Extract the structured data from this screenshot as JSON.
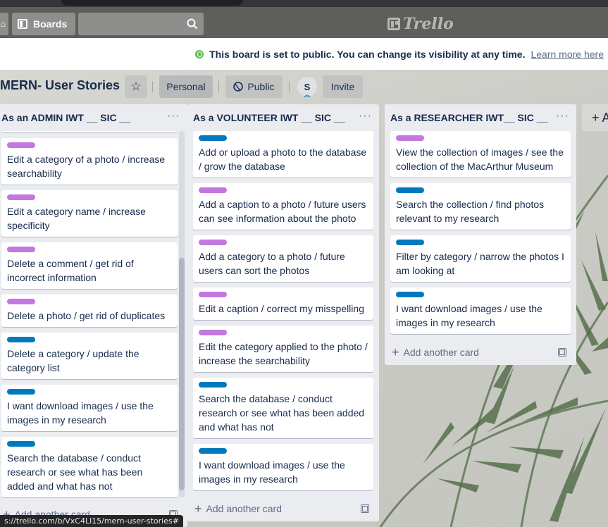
{
  "header": {
    "boards_label": "Boards",
    "logo_text": "Trello",
    "icons": [
      "home-icon",
      "boards-icon",
      "search-icon"
    ]
  },
  "banner": {
    "message": "This board is set to public. You can change its visibility at any time.",
    "link": "Learn more here",
    "icon": "globe-icon"
  },
  "board": {
    "title": "MERN- User Stories",
    "personal_label": "Personal",
    "public_label": "Public",
    "member_initial": "S",
    "invite_label": "Invite"
  },
  "colors": {
    "purple_label": "#c377e0",
    "blue_label": "#0079bf"
  },
  "lists": [
    {
      "title": "As an ADMIN IWT __ SIC __",
      "add_card": "Add another card",
      "cards": [
        {
          "label": "purple",
          "text": "Edit a category of a photo / increase searchability"
        },
        {
          "label": "purple",
          "text": "Edit a category name / increase specificity"
        },
        {
          "label": "purple",
          "text": "Delete a comment / get rid of incorrect information"
        },
        {
          "label": "purple",
          "text": "Delete a photo / get rid of duplicates"
        },
        {
          "label": "blue",
          "text": "Delete a category / update the category list"
        },
        {
          "label": "blue",
          "text": "I want download images / use the images in my research"
        },
        {
          "label": "blue",
          "text": "Search the database / conduct research or see what has been added and what has not"
        }
      ]
    },
    {
      "title": "As a VOLUNTEER IWT __ SIC __",
      "add_card": "Add another card",
      "cards": [
        {
          "label": "blue",
          "text": "Add or upload a photo to the database / grow the database"
        },
        {
          "label": "purple",
          "text": "Add a caption to a photo / future users can see information about the photo"
        },
        {
          "label": "purple",
          "text": "Add a category to a photo / future users can sort the photos"
        },
        {
          "label": "purple",
          "text": "Edit a caption / correct my misspelling"
        },
        {
          "label": "purple",
          "text": "Edit the category applied to the photo / increase the searchability"
        },
        {
          "label": "blue",
          "text": "Search the database / conduct research or see what has been added and what has not"
        },
        {
          "label": "blue",
          "text": "I want download images / use the images in my research"
        }
      ]
    },
    {
      "title": "As a RESEARCHER IWT__ SIC __",
      "add_card": "Add another card",
      "cards": [
        {
          "label": "purple",
          "text": "View the collection of images / see the collection of the MacArthur Museum"
        },
        {
          "label": "blue",
          "text": "Search the collection / find photos relevant to my research"
        },
        {
          "label": "blue",
          "text": "Filter by category / narrow the photos I am looking at"
        },
        {
          "label": "blue",
          "text": "I want download images / use the images in my research"
        }
      ]
    }
  ],
  "add_list_label": "+ A",
  "status_url": "s://trello.com/b/VxC4Ll15/mern-user-stories#"
}
